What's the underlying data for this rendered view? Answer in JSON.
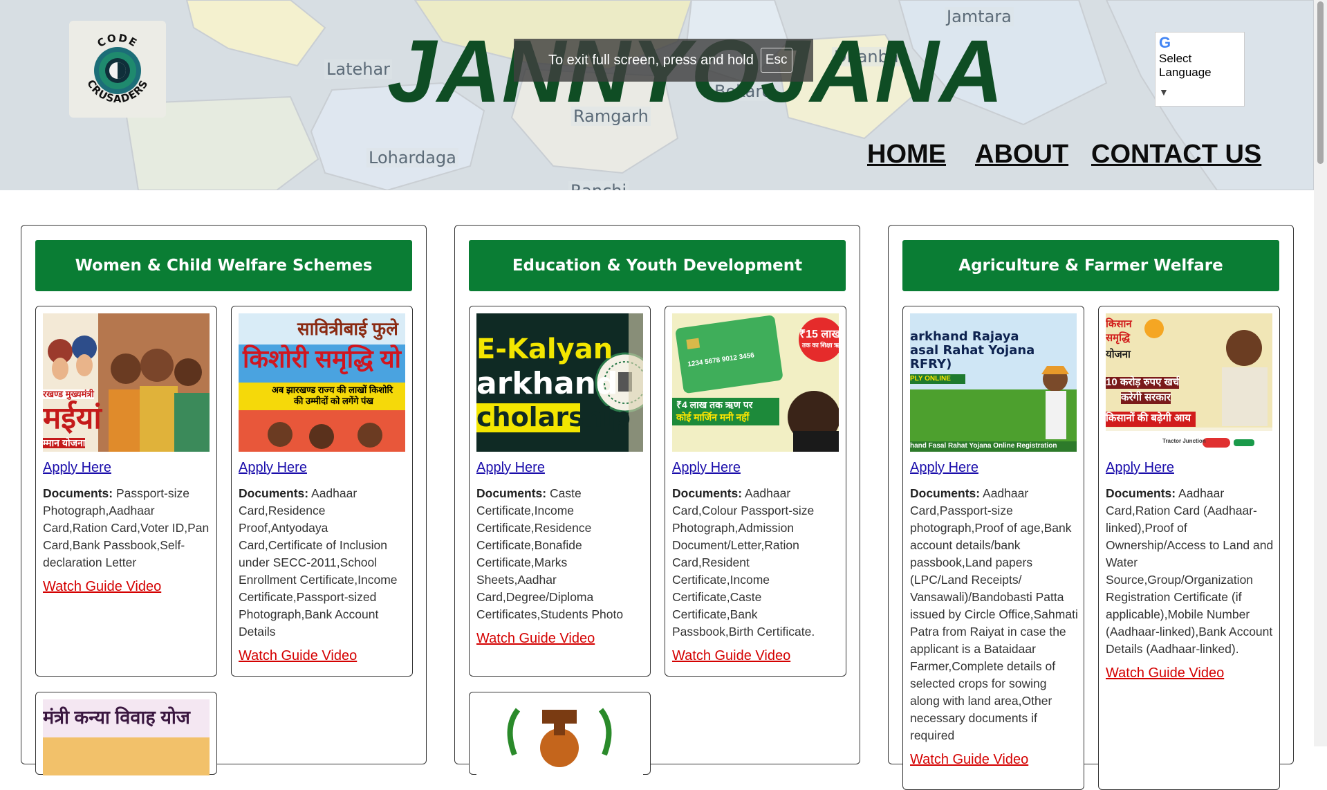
{
  "header": {
    "title": "JANNYOJANA",
    "map_labels": [
      "Latehar",
      "Ramgarh",
      "Lohardaga",
      "Jamtara",
      "Dhanba",
      "Bokaro",
      "Ranchi"
    ],
    "logo": {
      "top": "CODE",
      "bottom": "CRUSADERS"
    },
    "fullscreen_notice": "To exit full screen, press and hold",
    "fullscreen_key": "Esc",
    "language_select": {
      "label": "Select Language",
      "icon": "google-g-icon"
    },
    "nav": [
      "HOME",
      "ABOUT",
      "CONTACT US"
    ]
  },
  "colors": {
    "accent": "#0a7d34",
    "title": "#0f4d24",
    "link": "#1a0dab",
    "video_link": "#d40000"
  },
  "categories": [
    {
      "title": "Women & Child Welfare Schemes",
      "cards": [
        {
          "image_text": [
            "रखण्ड मुख्यमंत्री",
            "मईयां",
            "म्मान योजना"
          ],
          "apply_label": "Apply Here",
          "docs_label": "Documents:",
          "docs": "Passport-size Photograph,Aadhaar Card,Ration Card,Voter ID,Pan Card,Bank Passbook,Self-declaration Letter",
          "video_label": "Watch Guide Video"
        },
        {
          "image_text": [
            "सावित्रीबाई फुले",
            "किशोरी समृद्धि यो",
            "अब झारखण्ड राज्य की लाखों किशोरि",
            "की उम्मीदों को लगेंगे पंख"
          ],
          "apply_label": "Apply Here",
          "docs_label": "Documents:",
          "docs": "Aadhaar Card,Residence Proof,Antyodaya Card,Certificate of Inclusion under SECC-2011,School Enrollment Certificate,Income Certificate,Passport-sized Photograph,Bank Account Details",
          "video_label": "Watch Guide Video"
        },
        {
          "image_text": [
            "मंत्री कन्या विवाह योज"
          ]
        }
      ]
    },
    {
      "title": "Education & Youth Development",
      "cards": [
        {
          "image_text": [
            "E-Kalyan",
            "arkhand",
            "cholarship"
          ],
          "apply_label": "Apply Here",
          "docs_label": "Documents:",
          "docs": "Caste Certificate,Income Certificate,Residence Certificate,Bonafide Certificate,Marks Sheets,Aadhar Card,Degree/Diploma Certificates,Students Photo",
          "video_label": "Watch Guide Video"
        },
        {
          "image_text": [
            "₹15 लाख",
            "तक का शिक्षा ऋण",
            "1234 5678 9012 3456",
            "₹4 लाख तक ऋण पर",
            "कोई मार्जिन मनी नहीं"
          ],
          "apply_label": "Apply Here",
          "docs_label": "Documents:",
          "docs": "Aadhaar Card,Colour Passport-size Photograph,Admission Document/Letter,Ration Card,Resident Certificate,Income Certificate,Caste Certificate,Bank Passbook,Birth Certificate.",
          "video_label": "Watch Guide Video"
        },
        {
          "image_text": []
        }
      ]
    },
    {
      "title": "Agriculture & Farmer Welfare",
      "cards": [
        {
          "image_text": [
            "arkhand Rajaya",
            "asal Rahat Yojana",
            "RFRY)",
            "PLY ONLINE",
            "hand Fasal Rahat Yojana Online Registration"
          ],
          "apply_label": "Apply Here",
          "docs_label": "Documents:",
          "docs": "Aadhaar Card,Passport-size photograph,Proof of age,Bank account details/bank passbook,Land papers (LPC/Land Receipts/ Vansawali)/Bandobasti Patta issued by Circle Office,Sahmati Patra from Raiyat in case the applicant is a Bataidaar Farmer,Complete details of selected crops for sowing along with land area,Other necessary documents if required",
          "video_label": "Watch Guide Video"
        },
        {
          "image_text": [
            "किसान",
            "समृद्धि",
            "योजना",
            "10 करोड़ रुपए खर्च",
            "करेगी सरकार",
            "किसानों की बढ़ेगी आय",
            "Tractor Junction"
          ],
          "apply_label": "Apply Here",
          "docs_label": "Documents:",
          "docs": "Aadhaar Card,Ration Card (Aadhaar-linked),Proof of Ownership/Access to Land and Water Source,Group/Organization Registration Certificate (if applicable),Mobile Number (Aadhaar-linked),Bank Account Details (Aadhaar-linked).",
          "video_label": "Watch Guide Video"
        }
      ]
    }
  ]
}
